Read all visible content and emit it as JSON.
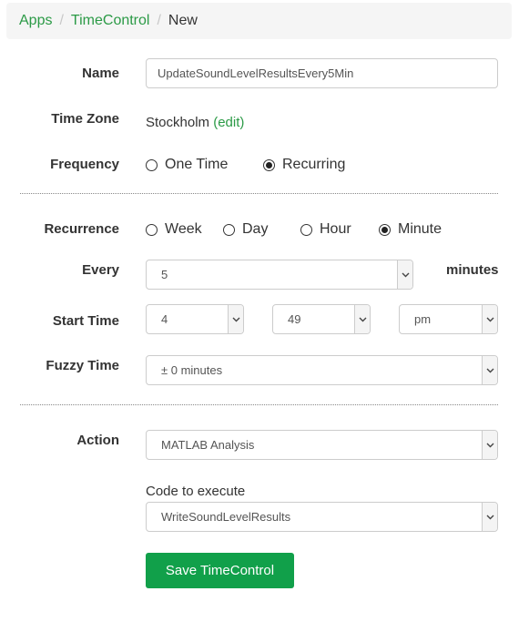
{
  "breadcrumb": {
    "items": [
      "Apps",
      "TimeControl"
    ],
    "separator": "/",
    "current": "New"
  },
  "form": {
    "name": {
      "label": "Name",
      "value": "UpdateSoundLevelResultsEvery5Min"
    },
    "time_zone": {
      "label": "Time Zone",
      "value": "Stockholm",
      "edit_open": " (",
      "edit_label": "edit",
      "edit_close": ")"
    },
    "frequency": {
      "label": "Frequency",
      "options": [
        "One Time",
        "Recurring"
      ],
      "selected": "Recurring"
    },
    "recurrence": {
      "label": "Recurrence",
      "options": [
        "Week",
        "Day",
        "Hour",
        "Minute"
      ],
      "selected": "Minute"
    },
    "every": {
      "label": "Every",
      "value": "5",
      "unit": "minutes"
    },
    "start_time": {
      "label": "Start Time",
      "hour": "4",
      "minute": "49",
      "period": "pm"
    },
    "fuzzy_time": {
      "label": "Fuzzy Time",
      "value": "± 0 minutes"
    },
    "action": {
      "label": "Action",
      "value": "MATLAB Analysis"
    },
    "code": {
      "label": "Code to execute",
      "value": "WriteSoundLevelResults"
    },
    "save_label": "Save TimeControl"
  },
  "icons": {
    "caret": "chevron-down-icon",
    "radio": "radio-button-icon"
  },
  "colors": {
    "link": "#2b9a46",
    "primary_button": "#11a04a"
  }
}
